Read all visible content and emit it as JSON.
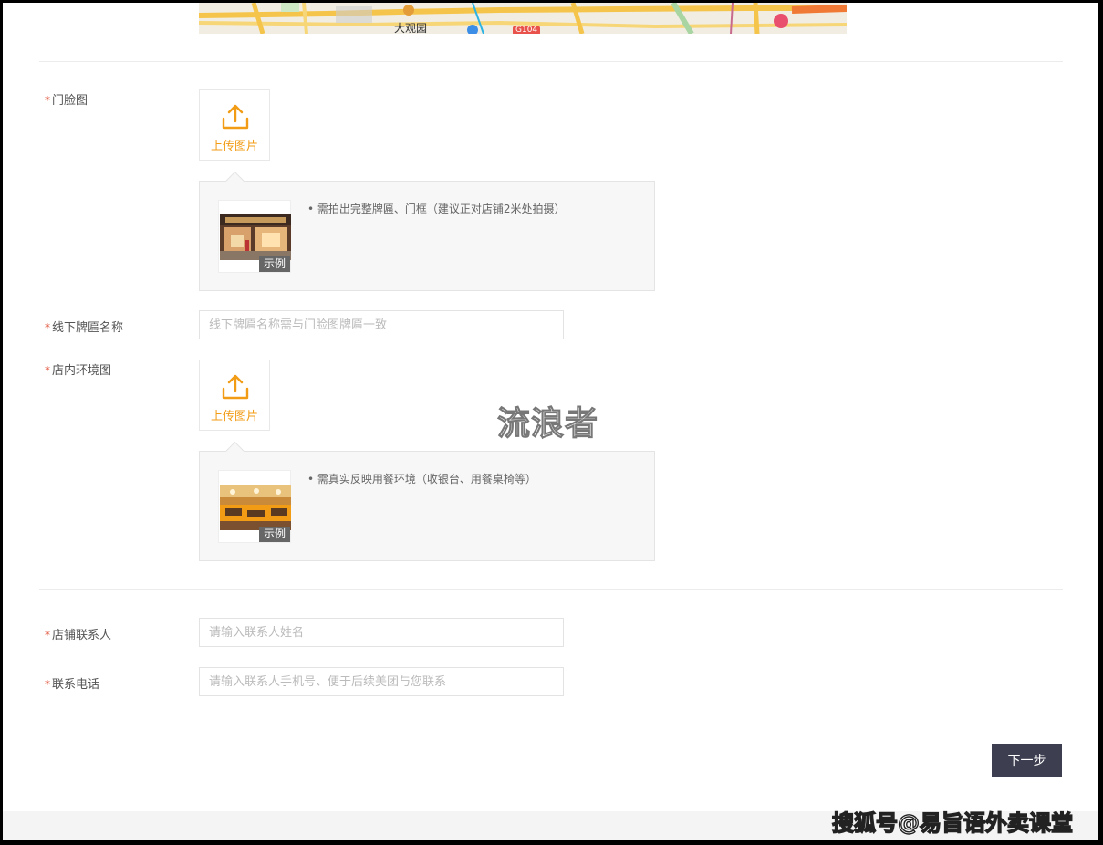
{
  "map": {
    "place_label": "大观园",
    "road_badge": "G104"
  },
  "form": {
    "storefront": {
      "required_mark": "*",
      "label": "门脸图",
      "upload_label": "上传图片",
      "tip": "• 需拍出完整牌匾、门框（建议正对店铺2米处拍摄）",
      "sample_tag": "示例"
    },
    "sign_name": {
      "required_mark": "*",
      "label": "线下牌匾名称",
      "placeholder": "线下牌匾名称需与门脸图牌匾一致"
    },
    "interior": {
      "required_mark": "*",
      "label": "店内环境图",
      "upload_label": "上传图片",
      "tip": "• 需真实反映用餐环境（收银台、用餐桌椅等）",
      "sample_tag": "示例"
    },
    "contact_name": {
      "required_mark": "*",
      "label": "店铺联系人",
      "placeholder": "请输入联系人姓名"
    },
    "contact_phone": {
      "required_mark": "*",
      "label": "联系电话",
      "placeholder": "请输入联系人手机号、便于后续美团与您联系"
    },
    "next_label": "下一步"
  },
  "watermarks": {
    "center": "流浪者",
    "corner": "搜狐号@易旨语外卖课堂"
  },
  "colors": {
    "accent": "#f29c16",
    "required": "#e0533b",
    "button": "#3d3f50"
  }
}
